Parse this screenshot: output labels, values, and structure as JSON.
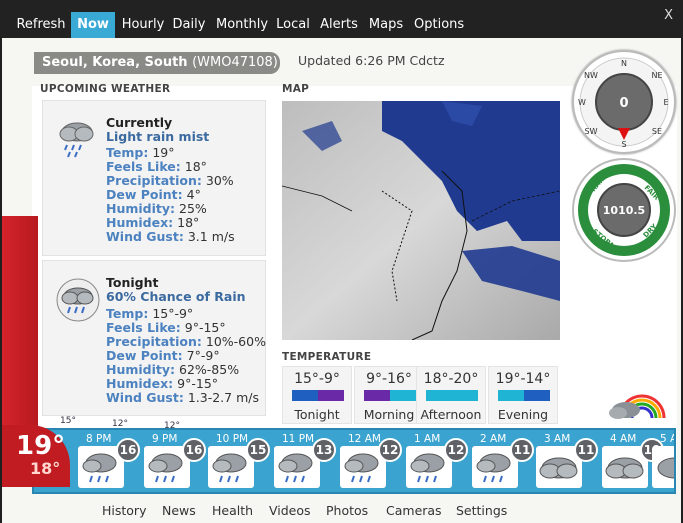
{
  "nav": {
    "tabs": [
      {
        "label": "Refresh",
        "active": false
      },
      {
        "label": "Now",
        "active": true
      },
      {
        "label": "Hourly",
        "active": false
      },
      {
        "label": "Daily",
        "active": false
      },
      {
        "label": "Monthly",
        "active": false
      },
      {
        "label": "Local",
        "active": false
      },
      {
        "label": "Alerts",
        "active": false
      },
      {
        "label": "Maps",
        "active": false
      },
      {
        "label": "Options",
        "active": false
      }
    ],
    "close": "X"
  },
  "location": {
    "name": "Seoul, Korea, South",
    "code": "(WMO47108)"
  },
  "updated": "Updated 6:26 PM Cdctz",
  "upcoming": {
    "title": "UPCOMING WEATHER",
    "current": {
      "title": "Currently",
      "condition": "Light rain mist",
      "rows": [
        {
          "label": "Temp:",
          "value": "19°"
        },
        {
          "label": "Feels Like:",
          "value": "18°"
        },
        {
          "label": "Precipitation:",
          "value": "30%"
        },
        {
          "label": "Dew Point:",
          "value": "4°"
        },
        {
          "label": "Humidity:",
          "value": "25%"
        },
        {
          "label": "Humidex:",
          "value": "18°"
        },
        {
          "label": "Wind Gust:",
          "value": "3.1 m/s"
        }
      ]
    },
    "tonight": {
      "title": "Tonight",
      "condition": "60% Chance of Rain",
      "rows": [
        {
          "label": "Temp:",
          "value": "15°-9°"
        },
        {
          "label": "Feels Like:",
          "value": "9°-15°"
        },
        {
          "label": "Precipitation:",
          "value": "10%-60%"
        },
        {
          "label": "Dew Point:",
          "value": "7°-9°"
        },
        {
          "label": "Humidity:",
          "value": "62%-85%"
        },
        {
          "label": "Humidex:",
          "value": "9°-15°"
        },
        {
          "label": "Wind Gust:",
          "value": "1.3-2.7 m/s"
        }
      ]
    },
    "graph_labels": [
      "15°",
      "12°",
      "12°"
    ]
  },
  "map": {
    "title": "MAP"
  },
  "temperature": {
    "title": "TEMPERATURE",
    "periods": [
      {
        "range": "15°-9°",
        "label": "Tonight",
        "colors": [
          "#1f5fbf",
          "#6a2aa8"
        ]
      },
      {
        "range": "9°-16°",
        "label": "Morning",
        "colors": [
          "#6a2aa8",
          "#1fb3d4"
        ]
      },
      {
        "range": "18°-20°",
        "label": "Afternoon",
        "colors": [
          "#1fb3d4",
          "#1fb3d4"
        ]
      },
      {
        "range": "19°-14°",
        "label": "Evening",
        "colors": [
          "#1fb3d4",
          "#1f5fbf"
        ]
      }
    ]
  },
  "compass": {
    "value": "0",
    "dirs": [
      "N",
      "NE",
      "E",
      "SE",
      "S",
      "SW",
      "W",
      "NW"
    ]
  },
  "pressure": {
    "value": "1010.5",
    "labels": [
      "RAIN",
      "FAIR",
      "STORM",
      "DRY"
    ]
  },
  "current_temp": {
    "main": "19°",
    "feels": "18°"
  },
  "hourly": [
    {
      "time": "8 PM",
      "temp": "16",
      "icon": "rain-cloud-icon"
    },
    {
      "time": "9 PM",
      "temp": "16",
      "icon": "rain-cloud-icon"
    },
    {
      "time": "10 PM",
      "temp": "15",
      "icon": "rain-cloud-icon"
    },
    {
      "time": "11 PM",
      "temp": "13",
      "icon": "rain-cloud-icon"
    },
    {
      "time": "12 AM",
      "temp": "12",
      "icon": "rain-cloud-icon"
    },
    {
      "time": "1 AM",
      "temp": "12",
      "icon": "rain-cloud-icon"
    },
    {
      "time": "2 AM",
      "temp": "11",
      "icon": "rain-cloud-icon"
    },
    {
      "time": "3 AM",
      "temp": "11",
      "icon": "cloud-icon"
    },
    {
      "time": "4 AM",
      "temp": "10",
      "icon": "cloud-icon"
    },
    {
      "time": "5 A",
      "temp": "",
      "icon": "cloud-icon"
    }
  ],
  "bottom_nav": [
    "History",
    "News",
    "Health",
    "Videos",
    "Photos",
    "Cameras",
    "Settings"
  ]
}
